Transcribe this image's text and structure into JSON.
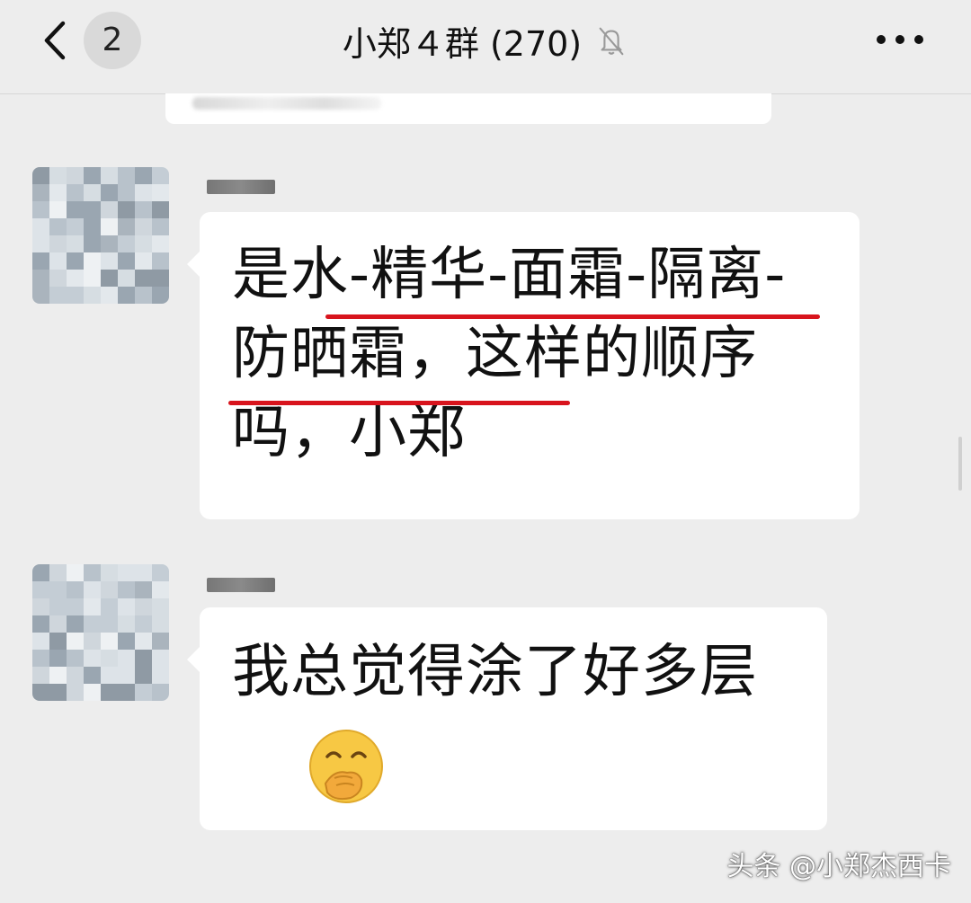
{
  "header": {
    "back_label": "back",
    "unread_count": "2",
    "title": "小郑４群 (270)",
    "mute_icon": "bell-muted-icon",
    "more_icon": "more-dots-icon"
  },
  "messages": [
    {
      "text": "是水-精华-面霜-隔离-防晒霜，这样的顺序吗，小郑"
    },
    {
      "text": "我总觉得涂了好多层",
      "emoji": "hand-over-mouth-emoji"
    }
  ],
  "watermark": "头条 @小郑杰西卡",
  "colors": {
    "background": "#ededed",
    "bubble": "#ffffff",
    "underline": "#d8141d",
    "text": "#111111"
  }
}
